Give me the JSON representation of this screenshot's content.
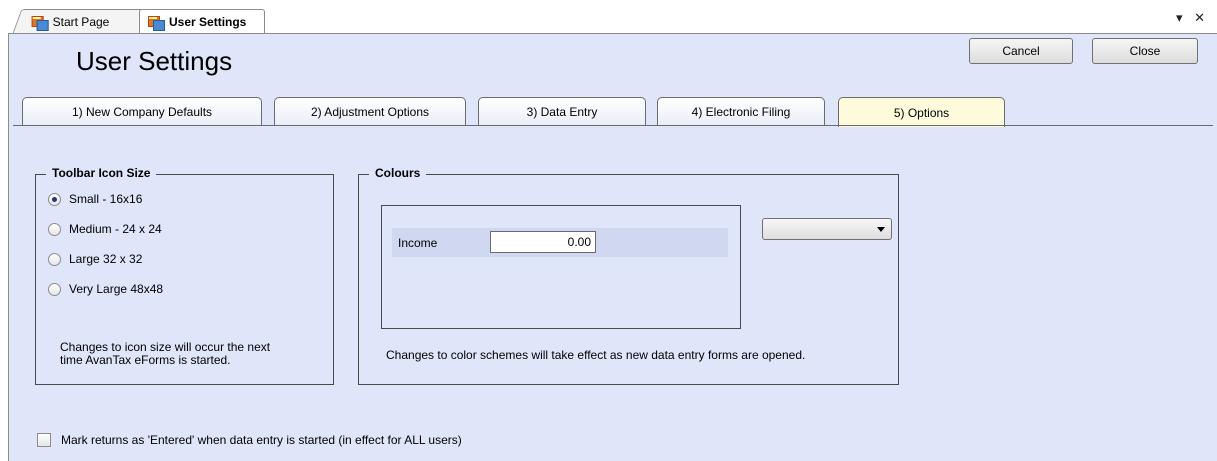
{
  "doc_tabs": [
    {
      "label": "Start Page",
      "icon": "app-window-icon"
    },
    {
      "label": "User Settings",
      "icon": "app-window-icon"
    }
  ],
  "strip_controls": "▾ ✕",
  "page_title": "User Settings",
  "buttons": {
    "cancel": "Cancel",
    "close": "Close"
  },
  "settings_tabs": [
    {
      "label": "1) New Company Defaults"
    },
    {
      "label": "2) Adjustment Options"
    },
    {
      "label": "3) Data Entry"
    },
    {
      "label": "4) Electronic Filing"
    },
    {
      "label": "5) Options",
      "active": true
    }
  ],
  "toolbar_icon_size": {
    "legend": "Toolbar Icon Size",
    "options": [
      {
        "label": "Small - 16x16",
        "checked": true
      },
      {
        "label": "Medium - 24 x 24",
        "checked": false
      },
      {
        "label": "Large 32 x 32",
        "checked": false
      },
      {
        "label": "Very Large 48x48",
        "checked": false
      }
    ],
    "note_line1": "Changes to icon size will occur the next",
    "note_line2": "time AvanTax eForms is started."
  },
  "colours": {
    "legend": "Colours",
    "income_label": "Income",
    "income_value": "0.00",
    "dropdown_value": "",
    "note": "Changes to color schemes will take effect as new data entry forms are opened."
  },
  "mark_entered": {
    "label": "Mark returns as 'Entered' when data entry is started (in effect for ALL users)",
    "checked": false
  },
  "colors": {
    "form_background": "#dfe6f9",
    "active_tab": "#fdfbdc"
  }
}
